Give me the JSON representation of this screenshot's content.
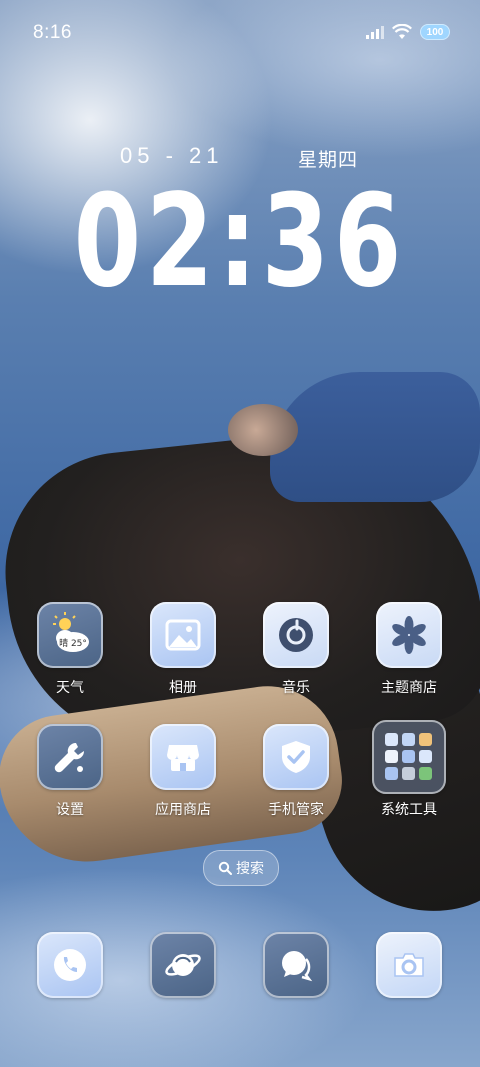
{
  "status_bar": {
    "time": "8:16",
    "battery": "100"
  },
  "lock_widget": {
    "date": "05 - 21",
    "weekday": "星期四",
    "clock": "02:36"
  },
  "apps": [
    {
      "label": "天气",
      "icon": "weather-icon",
      "weather_text": "晴 25°"
    },
    {
      "label": "相册",
      "icon": "gallery-icon"
    },
    {
      "label": "音乐",
      "icon": "music-icon"
    },
    {
      "label": "主题商店",
      "icon": "theme-store-icon"
    },
    {
      "label": "设置",
      "icon": "settings-icon"
    },
    {
      "label": "应用商店",
      "icon": "app-store-icon"
    },
    {
      "label": "手机管家",
      "icon": "phone-manager-icon"
    },
    {
      "label": "系统工具",
      "icon": "system-tools-folder-icon"
    }
  ],
  "search": {
    "label": "搜索"
  },
  "dock": [
    {
      "icon": "phone-icon"
    },
    {
      "icon": "browser-icon"
    },
    {
      "icon": "messages-icon"
    },
    {
      "icon": "camera-icon"
    }
  ],
  "colors": {
    "icon_light": "#dbe7fb",
    "icon_accent": "#a9c4f2",
    "icon_dark": "#4b6486",
    "sky": "#3d67a3"
  }
}
